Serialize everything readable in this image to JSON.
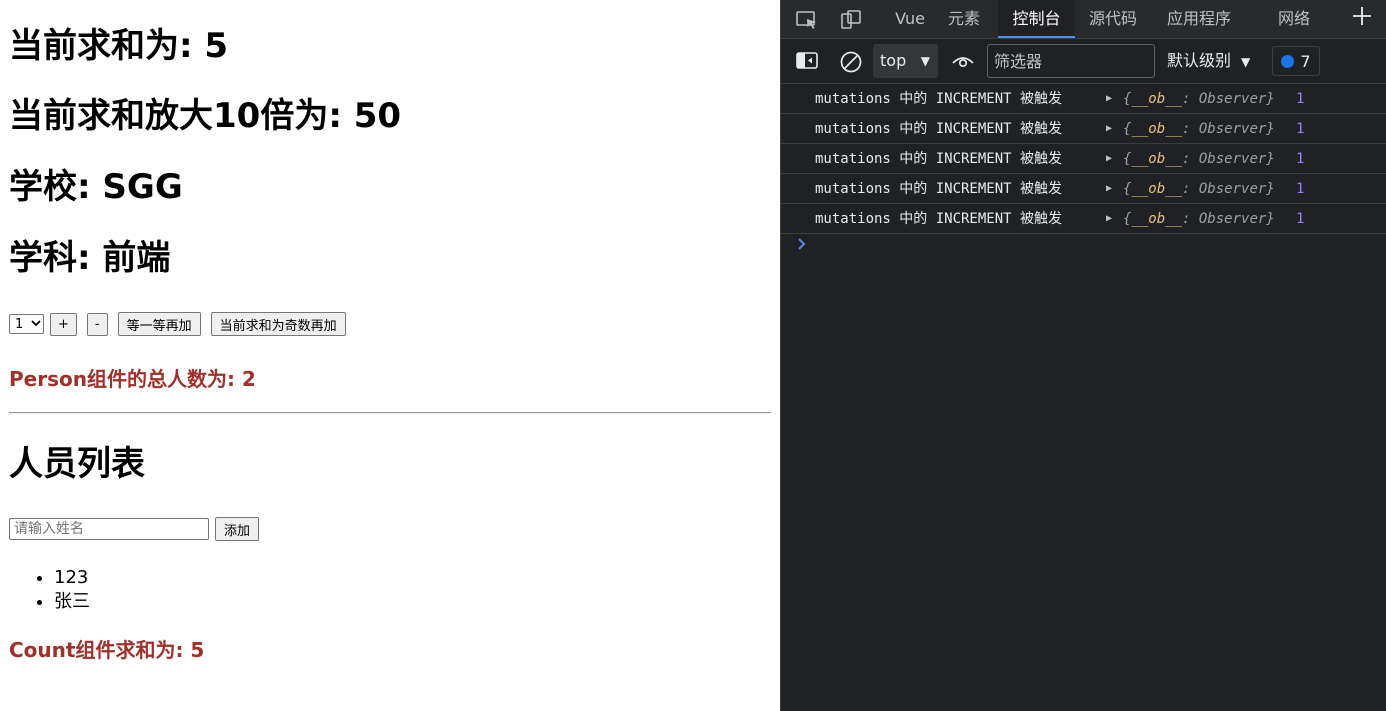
{
  "app": {
    "sum_heading": "当前求和为: 5",
    "bigsum_heading": "当前求和放大10倍为: 50",
    "school_heading": "学校: SGG",
    "subject_heading": "学科: 前端",
    "select_value": "1",
    "plus_label": "+",
    "minus_label": "-",
    "wait_add_label": "等一等再加",
    "odd_add_label": "当前求和为奇数再加",
    "person_total": "Person组件的总人数为: 2",
    "person_list_heading": "人员列表",
    "name_input_placeholder": "请输入姓名",
    "add_button_label": "添加",
    "persons": [
      "123",
      "张三"
    ],
    "count_sum": "Count组件求和为: 5",
    "colors": {
      "accent_red": "#a0302a"
    }
  },
  "devtools": {
    "tabs": [
      "Vue",
      "元素",
      "控制台",
      "源代码",
      "应用程序",
      "网络"
    ],
    "active_tab": "控制台",
    "context": "top",
    "filter_placeholder": "筛选器",
    "levels": "默认级别",
    "message_count": "7",
    "logs": [
      {
        "text": "mutations 中的 INCREMENT 被触发",
        "obj_open": "{",
        "obj_key": "__ob__",
        "obj_rest": ": Observer}",
        "value": "1"
      },
      {
        "text": "mutations 中的 INCREMENT 被触发",
        "obj_open": "{",
        "obj_key": "__ob__",
        "obj_rest": ": Observer}",
        "value": "1"
      },
      {
        "text": "mutations 中的 INCREMENT 被触发",
        "obj_open": "{",
        "obj_key": "__ob__",
        "obj_rest": ": Observer}",
        "value": "1"
      },
      {
        "text": "mutations 中的 INCREMENT 被触发",
        "obj_open": "{",
        "obj_key": "__ob__",
        "obj_rest": ": Observer}",
        "value": "1"
      },
      {
        "text": "mutations 中的 INCREMENT 被触发",
        "obj_open": "{",
        "obj_key": "__ob__",
        "obj_rest": ": Observer}",
        "value": "1"
      }
    ],
    "icons": [
      "inspect-icon",
      "device-toggle-icon",
      "add-tab-icon",
      "sidebar-icon",
      "clear-console-icon",
      "live-expression-icon",
      "message-bubble-icon",
      "prompt-chevron-icon"
    ],
    "colors": {
      "active_tab_underline": "#4d8ee8",
      "number": "#9980ff",
      "bubble": "#1a73e8"
    }
  }
}
